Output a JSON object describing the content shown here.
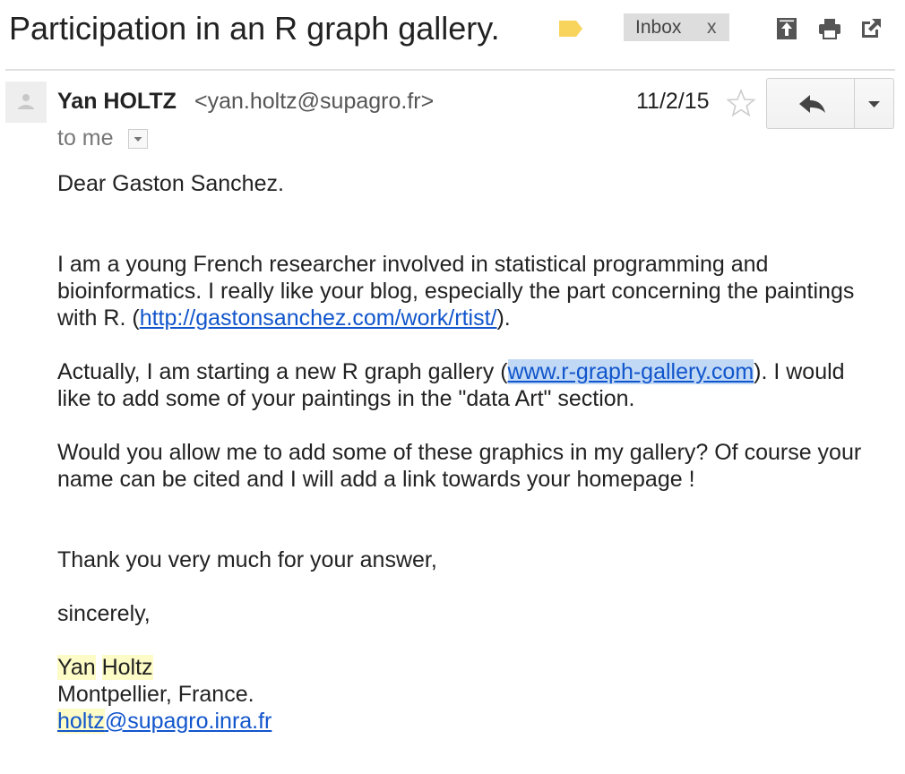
{
  "subject": "Participation in an R graph gallery.",
  "labels": {
    "inbox": "Inbox",
    "remove": "x"
  },
  "icons": {
    "label_tag": "label-tag-icon",
    "move_to_inbox": "move-to-inbox-icon",
    "print": "print-icon",
    "new_window": "open-in-new-window-icon",
    "star": "star-icon",
    "reply": "reply-icon",
    "more": "chevron-down-icon"
  },
  "colors": {
    "label_tag": "#f9d45c",
    "link": "#1155cc",
    "highlight": "#fdfbc6",
    "selection": "#c1d9f5"
  },
  "header": {
    "sender_name": "Yan HOLTZ",
    "sender_email": "<yan.holtz@supagro.fr>",
    "to": "to me",
    "date": "11/2/15"
  },
  "body": {
    "greeting": "Dear Gaston Sanchez.",
    "p1_text": "I am a young French researcher involved in statistical programming and bioinformatics. I really like your blog, especially the part concerning the paintings with R. (",
    "p1_link": "http://gastonsanchez.com/work/rtist/",
    "p1_end": ").",
    "p2_text": "Actually, I am starting a new R graph gallery (",
    "p2_link": "www.r-graph-gallery.com",
    "p2_end": "). I would like to add some of your paintings in the \"data Art\" section.",
    "p3": "Would you allow me to add some of these graphics in my gallery? Of course your name can be cited and I will add a link towards your homepage !",
    "thanks": "Thank you very much for your answer,",
    "closing": "sincerely,",
    "sig_first": "Yan",
    "sig_last": "Holtz",
    "sig_location": "Montpellier, France.",
    "sig_email_user": "holtz",
    "sig_email_domain": "@supagro.inra.fr"
  }
}
